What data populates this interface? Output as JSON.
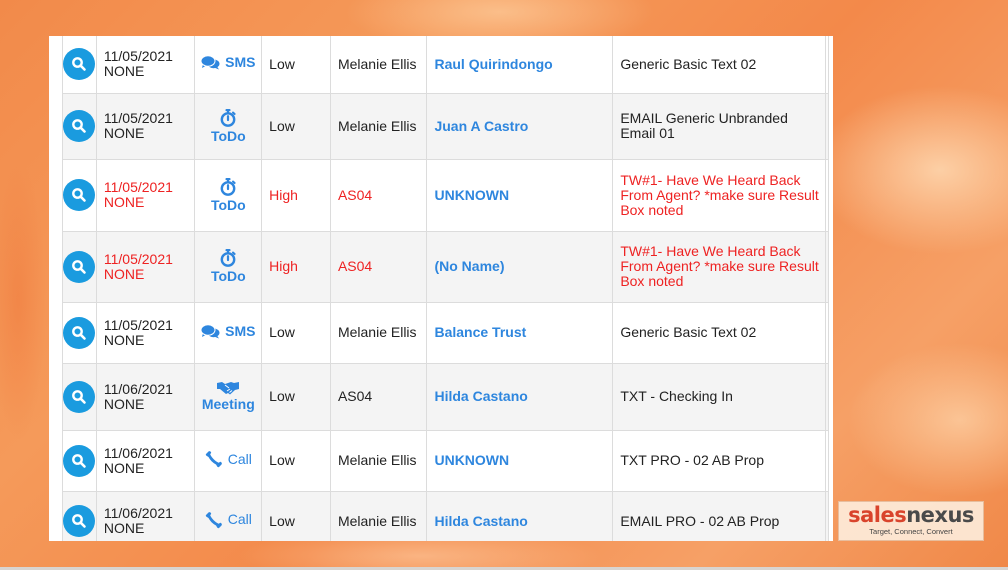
{
  "rows": [
    {
      "date": "11/05/2021",
      "status": "NONE",
      "type": "SMS",
      "type_icon": "sms-chat-icon",
      "priority": "Low",
      "owner": "Melanie Ellis",
      "contact": "Raul Quirindongo",
      "description": "Generic Basic Text 02",
      "overdue": false
    },
    {
      "date": "11/05/2021",
      "status": "NONE",
      "type": "ToDo",
      "type_icon": "stopwatch-icon",
      "priority": "Low",
      "owner": "Melanie Ellis",
      "contact": "Juan A Castro",
      "description": "EMAIL Generic Unbranded Email 01",
      "overdue": false
    },
    {
      "date": "11/05/2021",
      "status": "NONE",
      "type": "ToDo",
      "type_icon": "stopwatch-icon",
      "priority": "High",
      "owner": "AS04",
      "contact": "UNKNOWN",
      "description": "TW#1- Have We Heard Back From Agent? *make sure Result Box noted",
      "overdue": true
    },
    {
      "date": "11/05/2021",
      "status": "NONE",
      "type": "ToDo",
      "type_icon": "stopwatch-icon",
      "priority": "High",
      "owner": "AS04",
      "contact": "(No Name)",
      "description": "TW#1- Have We Heard Back From Agent? *make sure Result Box noted",
      "overdue": true
    },
    {
      "date": "11/05/2021",
      "status": "NONE",
      "type": "SMS",
      "type_icon": "sms-chat-icon",
      "priority": "Low",
      "owner": "Melanie Ellis",
      "contact": "Balance Trust",
      "description": "Generic Basic Text 02",
      "overdue": false
    },
    {
      "date": "11/06/2021",
      "status": "NONE",
      "type": "Meeting",
      "type_icon": "handshake-icon",
      "priority": "Low",
      "owner": "AS04",
      "contact": "Hilda Castano",
      "description": "TXT - Checking In",
      "overdue": false
    },
    {
      "date": "11/06/2021",
      "status": "NONE",
      "type": "Call",
      "type_icon": "phone-icon",
      "priority": "Low",
      "owner": "Melanie Ellis",
      "contact": "UNKNOWN",
      "description": "TXT PRO - 02 AB Prop",
      "overdue": false
    },
    {
      "date": "11/06/2021",
      "status": "NONE",
      "type": "Call",
      "type_icon": "phone-icon",
      "priority": "Low",
      "owner": "Melanie Ellis",
      "contact": "Hilda Castano",
      "description": "EMAIL PRO - 02 AB Prop",
      "overdue": false
    }
  ],
  "colors": {
    "accent_blue": "#1a9bdf",
    "link_blue": "#2e86de",
    "overdue_red": "#ee2222",
    "background_orange": "#f28a4a"
  },
  "logo": {
    "part1": "sales",
    "part2": "nexus",
    "tagline": "Target, Connect, Convert"
  }
}
